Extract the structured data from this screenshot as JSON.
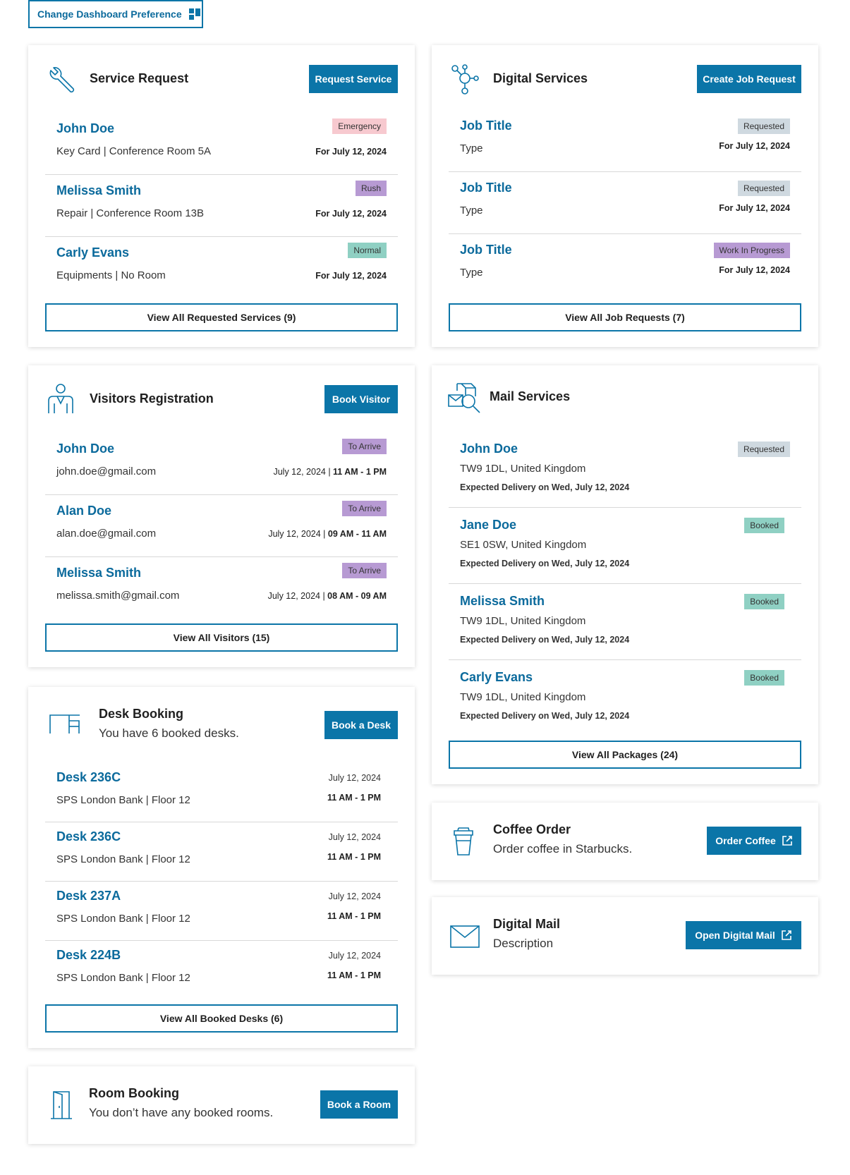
{
  "top": {
    "preference_label": "Change Dashboard Preference",
    "preference_icon": "dashboard-grid-icon"
  },
  "service_request": {
    "title": "Service Request",
    "icon": "wrench-icon",
    "action": "Request Service",
    "items": [
      {
        "name": "John Doe",
        "detail": "Key Card | Conference Room 5A",
        "badge": "Emergency",
        "date": "For July 12, 2024"
      },
      {
        "name": "Melissa Smith",
        "detail": "Repair | Conference Room 13B",
        "badge": "Rush",
        "date": "For July 12, 2024"
      },
      {
        "name": "Carly Evans",
        "detail": "Equipments | No Room",
        "badge": "Normal",
        "date": "For July 12, 2024"
      }
    ],
    "view_all": "View All Requested Services (9)"
  },
  "digital_services": {
    "title": "Digital Services",
    "icon": "network-nodes-icon",
    "action": "Create Job Request",
    "items": [
      {
        "name": "Job Title",
        "detail": "Type",
        "badge": "Requested",
        "date": "For July 12, 2024"
      },
      {
        "name": "Job Title",
        "detail": "Type",
        "badge": "Requested",
        "date": "For July 12, 2024"
      },
      {
        "name": "Job Title",
        "detail": "Type",
        "badge": "Work In Progress",
        "date": "For July 12, 2024"
      }
    ],
    "view_all": "View All Job Requests (7)"
  },
  "visitors": {
    "title": "Visitors Registration",
    "icon": "person-icon",
    "action": "Book Visitor",
    "items": [
      {
        "name": "John Doe",
        "detail": "john.doe@gmail.com",
        "badge": "To Arrive",
        "date": "July 12, 2024 | ",
        "time": "11 AM - 1 PM"
      },
      {
        "name": "Alan Doe",
        "detail": "alan.doe@gmail.com",
        "badge": "To Arrive",
        "date": "July 12, 2024 | ",
        "time": "09 AM - 11 AM"
      },
      {
        "name": "Melissa Smith",
        "detail": "melissa.smith@gmail.com",
        "badge": "To Arrive",
        "date": "July 12, 2024 | ",
        "time": "08 AM - 09 AM"
      }
    ],
    "view_all": "View All Visitors (15)"
  },
  "mail_services": {
    "title": "Mail Services",
    "icon": "package-search-icon",
    "items": [
      {
        "name": "John Doe",
        "detail": "TW9 1DL, United Kingdom",
        "badge": "Requested",
        "expected": "Expected Delivery on Wed, July 12, 2024"
      },
      {
        "name": "Jane Doe",
        "detail": "SE1 0SW, United Kingdom",
        "badge": "Booked",
        "expected": "Expected Delivery on Wed, July 12, 2024"
      },
      {
        "name": "Melissa Smith",
        "detail": "TW9 1DL, United Kingdom",
        "badge": "Booked",
        "expected": "Expected Delivery on Wed, July 12, 2024"
      },
      {
        "name": "Carly Evans",
        "detail": "TW9 1DL, United Kingdom",
        "badge": "Booked",
        "expected": "Expected Delivery on Wed, July 12, 2024"
      }
    ],
    "view_all": "View All Packages (24)"
  },
  "desk_booking": {
    "title": "Desk Booking",
    "subtitle": "You have 6 booked desks.",
    "icon": "desk-icon",
    "action": "Book a Desk",
    "items": [
      {
        "name": "Desk 236C",
        "detail": "SPS London Bank | Floor 12",
        "date": "July 12, 2024",
        "time": "11 AM - 1 PM"
      },
      {
        "name": "Desk 236C",
        "detail": "SPS London Bank | Floor 12",
        "date": "July 12, 2024",
        "time": "11 AM - 1 PM"
      },
      {
        "name": "Desk 237A",
        "detail": "SPS London Bank | Floor 12",
        "date": "July 12, 2024",
        "time": "11 AM - 1 PM"
      },
      {
        "name": "Desk 224B",
        "detail": "SPS London Bank | Floor 12",
        "date": "July 12, 2024",
        "time": "11 AM - 1 PM"
      }
    ],
    "view_all": "View All Booked Desks (6)"
  },
  "coffee": {
    "title": "Coffee Order",
    "subtitle": "Order coffee in Starbucks.",
    "icon": "coffee-cup-icon",
    "action": "Order Coffee",
    "action_icon": "external-link-icon"
  },
  "digital_mail": {
    "title": "Digital Mail",
    "subtitle": "Description",
    "icon": "envelope-icon",
    "action": "Open Digital Mail",
    "action_icon": "external-link-icon"
  },
  "room_booking": {
    "title": "Room Booking",
    "subtitle": "You don’t have any booked rooms.",
    "icon": "door-icon",
    "action": "Book a Room"
  },
  "colors": {
    "primary": "#0b75a8",
    "link": "#0b6a9c",
    "emergency": "#f7c9cf",
    "rush": "#b79ad3",
    "normal": "#8fd0c3",
    "requested": "#cfd9e0",
    "booked": "#8fd0c3"
  }
}
